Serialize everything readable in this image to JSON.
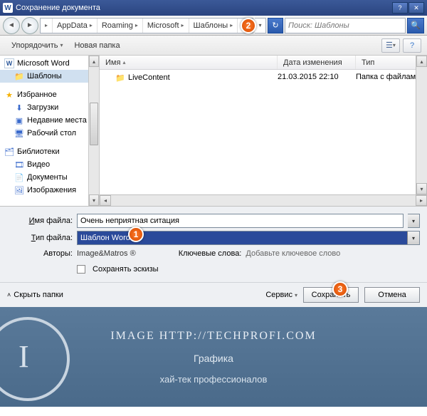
{
  "titlebar": {
    "title": "Сохранение документа"
  },
  "nav": {
    "crumbs": [
      "AppData",
      "Roaming",
      "Microsoft",
      "Шаблоны"
    ],
    "search_placeholder": "Поиск: Шаблоны"
  },
  "markers": {
    "m1": "1",
    "m2": "2",
    "m3": "3"
  },
  "toolbar": {
    "organize": "Упорядочить",
    "new_folder": "Новая папка"
  },
  "tree": {
    "word": "Microsoft Word",
    "templates": "Шаблоны",
    "favorites": "Избранное",
    "downloads": "Загрузки",
    "recent": "Недавние места",
    "desktop": "Рабочий стол",
    "libraries": "Библиотеки",
    "videos": "Видео",
    "documents": "Документы",
    "images": "Изображения"
  },
  "columns": {
    "name": "Имя",
    "date": "Дата изменения",
    "type": "Тип"
  },
  "rows": [
    {
      "name": "LiveContent",
      "date": "21.03.2015 22:10",
      "type": "Папка с файлами"
    }
  ],
  "form": {
    "file_label": "Имя файла:",
    "file_label_hotkey_char": "И",
    "file_value": "Очень неприятная ситация",
    "type_label": "Тип файла:",
    "type_label_hotkey_char": "Т",
    "type_value": "Шаблон Word",
    "authors_label": "Авторы:",
    "authors_value": "Image&Matros ®",
    "keywords_label": "Ключевые слова:",
    "keywords_hint": "Добавьте ключевое слово",
    "thumbnails": "Сохранять эскизы"
  },
  "bottom": {
    "hide_folders": "Скрыть папки",
    "service": "Сервис",
    "save": "Сохранить",
    "cancel": "Отмена"
  },
  "footer": {
    "line1": "IMAGE HTTP://TECHPROFI.COM",
    "line2": "Графика",
    "line3": "хай-тек профессионалов"
  }
}
